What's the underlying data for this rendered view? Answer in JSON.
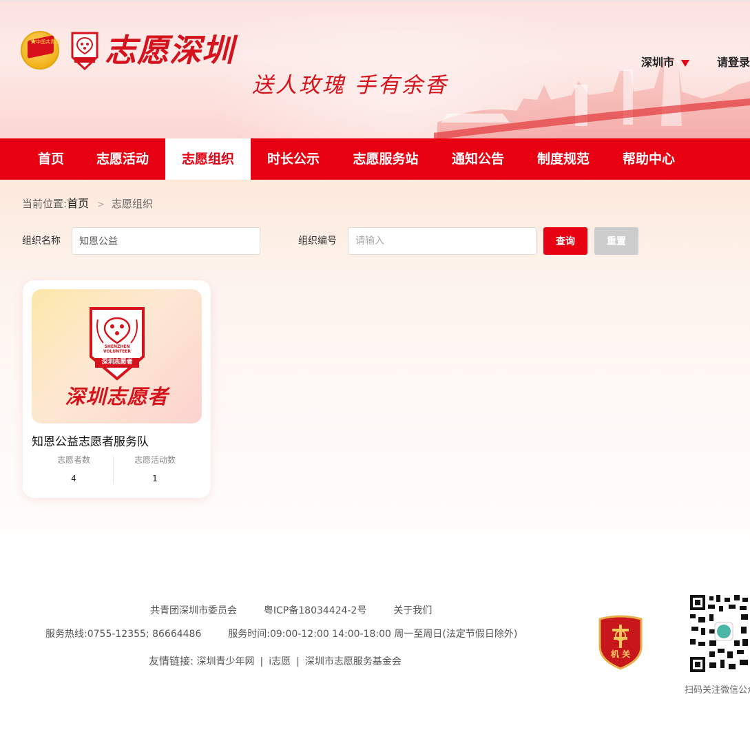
{
  "header": {
    "league_logo_text": "中国共青团",
    "volunteer_logo_text": "深圳志愿者",
    "site_title": "志愿深圳",
    "slogan": "送人玫瑰 手有余香",
    "city": "深圳市",
    "login": "请登录"
  },
  "nav": {
    "items": [
      {
        "label": "首页"
      },
      {
        "label": "志愿活动"
      },
      {
        "label": "志愿组织"
      },
      {
        "label": "时长公示"
      },
      {
        "label": "志愿服务站"
      },
      {
        "label": "通知公告"
      },
      {
        "label": "制度规范"
      },
      {
        "label": "帮助中心"
      }
    ],
    "active": "志愿组织",
    "accent_color": "#e60012"
  },
  "breadcrumb": {
    "prefix": "当前位置:",
    "home": "首页",
    "current": "志愿组织"
  },
  "filters": {
    "org_name_label": "组织名称",
    "org_name_value": "知恩公益",
    "org_code_label": "组织编号",
    "org_code_placeholder": "请输入",
    "query_button": "查询",
    "reset_button": "重置"
  },
  "results": [
    {
      "image_emblem_lines": [
        "SHENZHEN",
        "VOLUNTEER",
        "深圳志愿者"
      ],
      "image_caption": "深圳志愿者",
      "name": "知恩公益志愿者服务队",
      "volunteers_label": "志愿者数",
      "volunteers_count": "4",
      "activities_label": "志愿活动数",
      "activities_count": "1"
    }
  ],
  "footer": {
    "org": "共青团深圳市委员会",
    "icp": "粤ICP备18034424-2号",
    "about": "关于我们",
    "hotline": "服务热线:0755-12355; 86664486",
    "hours": "服务时间:09:00-12:00 14:00-18:00 周一至周日(法定节假日除外)",
    "friend_links_label": "友情链接:",
    "friend_links": [
      "深圳青少年网",
      "i志愿",
      "深圳市志愿服务基金会"
    ],
    "badge_text": "机 关",
    "qr_caption": "扫码关注微信公众号"
  }
}
